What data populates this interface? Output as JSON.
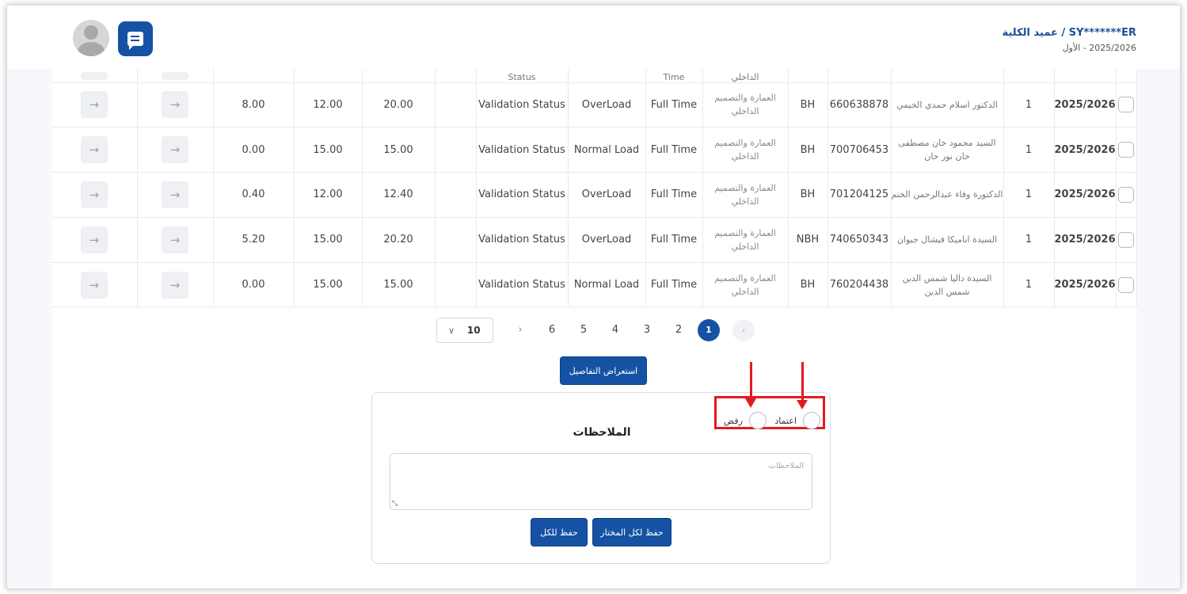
{
  "header": {
    "user_title": "SY*******ER / عميد الكلية",
    "user_subtitle": "2025/2026 - الأول"
  },
  "table": {
    "partial_row": {
      "status": "Status",
      "time": "Time",
      "dept": "الداخلي"
    },
    "rows": [
      {
        "year": "2025/2026",
        "semester": "1",
        "name": "الدكتور اسلام حمدي الخيمي",
        "id": "660638878",
        "type": "BH",
        "dept": "العمارة والتصميم الداخلي",
        "time": "Full Time",
        "load": "OverLoad",
        "validation": "Validation Status",
        "total": "20.00",
        "base": "12.00",
        "extra": "8.00",
        "arrow1": "→",
        "arrow2": "→"
      },
      {
        "year": "2025/2026",
        "semester": "1",
        "name": "السيد محمود خان مصطفى خان نور خان",
        "id": "700706453",
        "type": "BH",
        "dept": "العمارة والتصميم الداخلي",
        "time": "Full Time",
        "load": "Normal Load",
        "validation": "Validation Status",
        "total": "15.00",
        "base": "15.00",
        "extra": "0.00",
        "arrow1": "→",
        "arrow2": "→"
      },
      {
        "year": "2025/2026",
        "semester": "1",
        "name": "الدكتورة وفاء عبدالرحمن الختم",
        "id": "701204125",
        "type": "BH",
        "dept": "العمارة والتصميم الداخلي",
        "time": "Full Time",
        "load": "OverLoad",
        "validation": "Validation Status",
        "total": "12.40",
        "base": "12.00",
        "extra": "0.40",
        "arrow1": "→",
        "arrow2": "→"
      },
      {
        "year": "2025/2026",
        "semester": "1",
        "name": "السيدة اناميكا فيشال جيوان",
        "id": "740650343",
        "type": "NBH",
        "dept": "العمارة والتصميم الداخلي",
        "time": "Full Time",
        "load": "OverLoad",
        "validation": "Validation Status",
        "total": "20.20",
        "base": "15.00",
        "extra": "5.20",
        "arrow1": "→",
        "arrow2": "→"
      },
      {
        "year": "2025/2026",
        "semester": "1",
        "name": "السيدة داليا شمس الدين شمس الدين",
        "id": "760204438",
        "type": "BH",
        "dept": "العمارة والتصميم الداخلي",
        "time": "Full Time",
        "load": "Normal Load",
        "validation": "Validation Status",
        "total": "15.00",
        "base": "15.00",
        "extra": "0.00",
        "arrow1": "→",
        "arrow2": "→"
      }
    ]
  },
  "pagination": {
    "page_size": "10",
    "pages": [
      "1",
      "2",
      "3",
      "4",
      "5",
      "6"
    ],
    "current": "1",
    "next": "›",
    "prev": "‹",
    "chevron": "∨"
  },
  "buttons": {
    "view_details": "استعراض التفاصيل",
    "save_all": "حفظ للكل",
    "save_selected": "حفظ لكل المختار"
  },
  "notes": {
    "title": "الملاحظات",
    "placeholder": "الملاحظات",
    "approve_label": "اعتماد",
    "reject_label": "رفض"
  },
  "colors": {
    "primary": "#1652a4",
    "annotation": "#e21a22"
  }
}
